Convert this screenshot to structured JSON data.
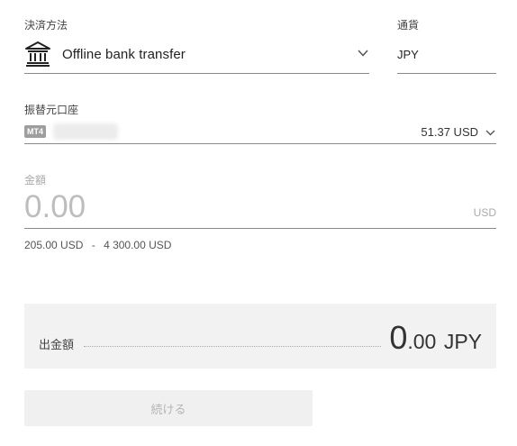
{
  "payment_method": {
    "label": "決済方法",
    "value": "Offline bank transfer",
    "icon": "bank-icon"
  },
  "currency": {
    "label": "通貨",
    "value": "JPY"
  },
  "source_account": {
    "label": "振替元口座",
    "badge": "MT4",
    "balance": "51.37 USD"
  },
  "amount": {
    "label": "金額",
    "placeholder": "0.00",
    "unit": "USD",
    "range_min": "205.00 USD",
    "separator": "-",
    "range_max": "4 300.00 USD"
  },
  "summary": {
    "label": "出金額",
    "value_int": "0",
    "value_dec": ".00",
    "currency": "JPY"
  },
  "continue_button": {
    "label": "続ける"
  },
  "colors": {
    "underline": "#8a8a8a",
    "summary_bg": "#f2f2f2",
    "button_bg": "#f0f0f0",
    "badge_bg": "#9e9e9e"
  }
}
